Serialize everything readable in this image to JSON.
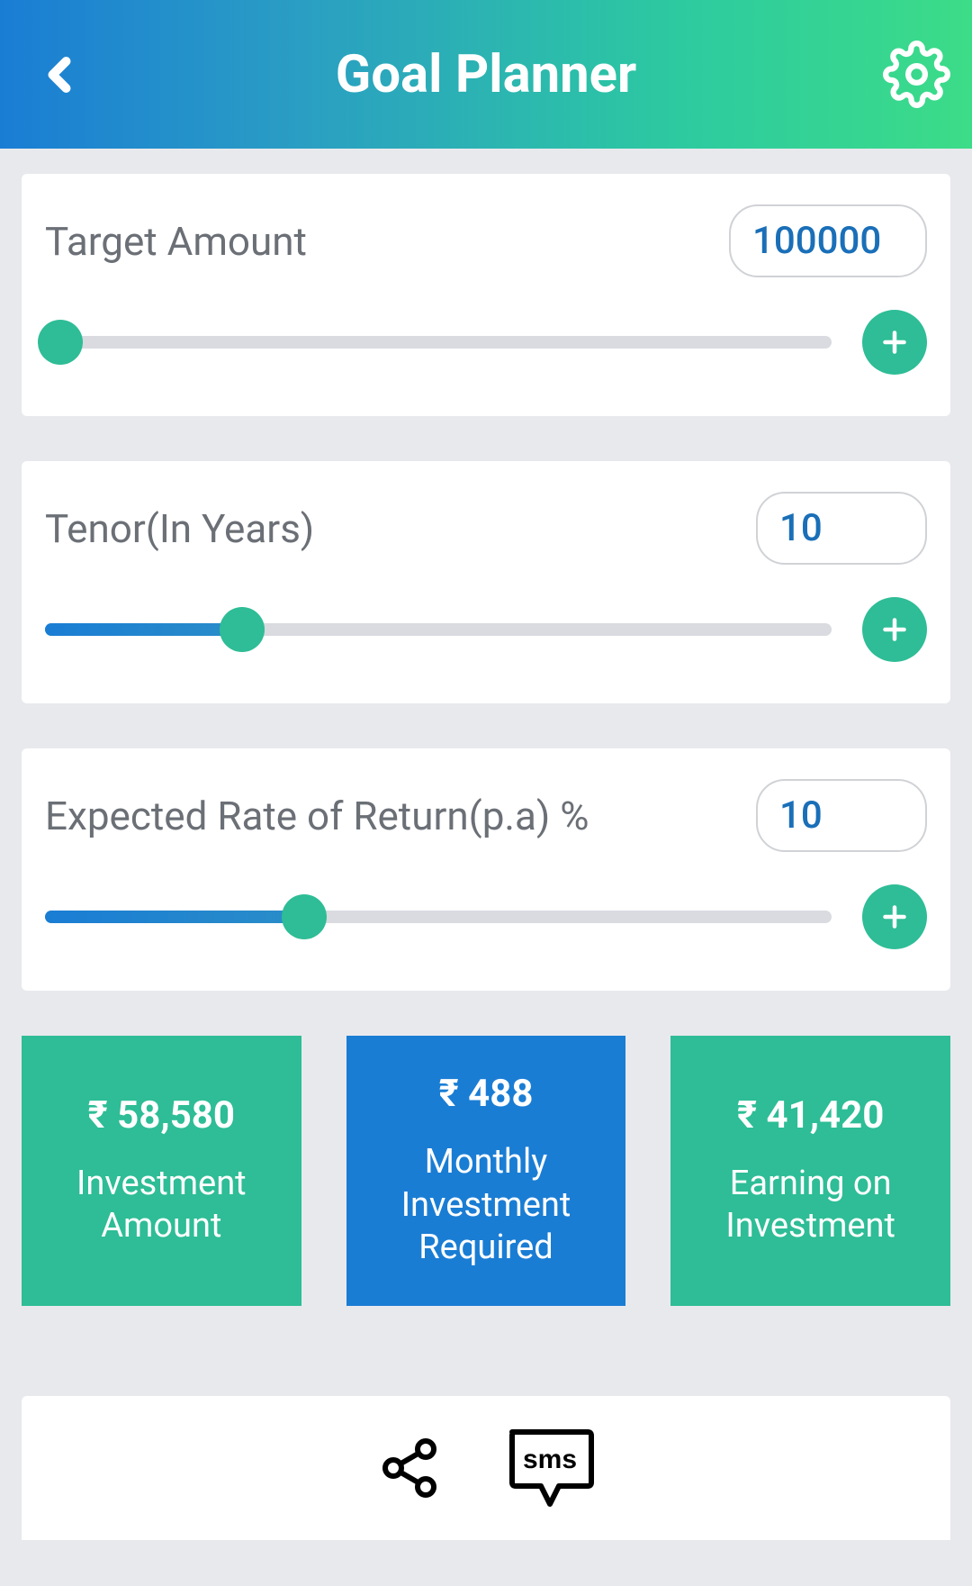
{
  "header": {
    "title": "Goal Planner"
  },
  "inputs": {
    "target_amount": {
      "label": "Target Amount",
      "value": "100000",
      "slider_percent": 2
    },
    "tenor": {
      "label": "Tenor(In Years)",
      "value": "10",
      "slider_percent": 25
    },
    "rate": {
      "label": "Expected Rate of Return(p.a) %",
      "value": "10",
      "slider_percent": 33
    }
  },
  "results": {
    "investment_amount": {
      "value": "₹ 58,580",
      "label": "Investment Amount"
    },
    "monthly_investment": {
      "value": "₹ 488",
      "label": "Monthly Investment Required"
    },
    "earning": {
      "value": "₹ 41,420",
      "label": "Earning on Investment"
    }
  }
}
